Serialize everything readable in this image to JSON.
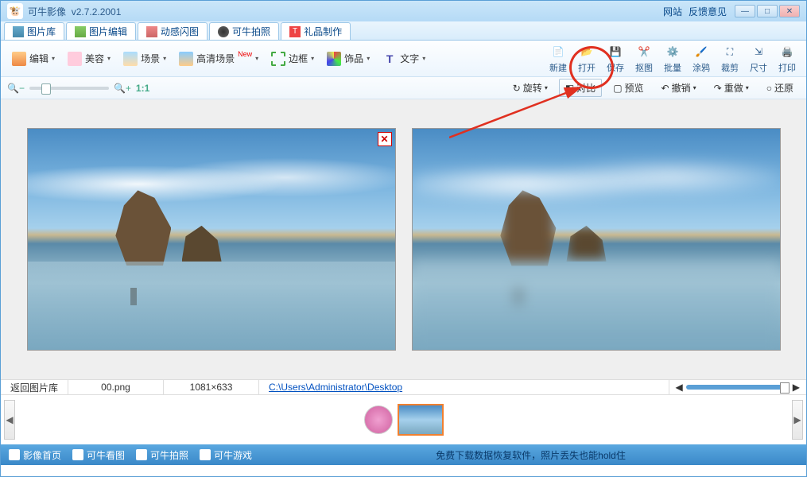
{
  "titlebar": {
    "app_name": "可牛影像",
    "version": "v2.7.2.2001",
    "links": {
      "website": "网站",
      "feedback": "反馈意见"
    }
  },
  "tabs": [
    {
      "label": "图片库"
    },
    {
      "label": "图片编辑"
    },
    {
      "label": "动感闪图"
    },
    {
      "label": "可牛拍照"
    },
    {
      "label": "礼品制作"
    }
  ],
  "categories": [
    {
      "label": "编辑"
    },
    {
      "label": "美容"
    },
    {
      "label": "场景"
    },
    {
      "label": "高清场景",
      "badge": "New"
    },
    {
      "label": "边框"
    },
    {
      "label": "饰品"
    },
    {
      "label": "文字"
    }
  ],
  "file_ops": [
    {
      "label": "新建"
    },
    {
      "label": "打开"
    },
    {
      "label": "保存"
    },
    {
      "label": "抠图"
    },
    {
      "label": "批量"
    },
    {
      "label": "涂鸦"
    },
    {
      "label": "裁剪"
    },
    {
      "label": "尺寸"
    },
    {
      "label": "打印"
    }
  ],
  "zoom": {
    "one_to_one": "1:1"
  },
  "actions": {
    "rotate": "旋转",
    "compare": "对比",
    "preview": "预览",
    "undo": "撤销",
    "redo": "重做",
    "restore": "还原"
  },
  "status": {
    "back": "返回图片库",
    "filename": "00.png",
    "dimensions": "1081×633",
    "path": "C:\\Users\\Administrator\\Desktop"
  },
  "footer": {
    "links": [
      {
        "label": "影像首页"
      },
      {
        "label": "可牛看图"
      },
      {
        "label": "可牛拍照"
      },
      {
        "label": "可牛游戏"
      }
    ],
    "message": "免费下载数据恢复软件，照片丢失也能hold住"
  }
}
